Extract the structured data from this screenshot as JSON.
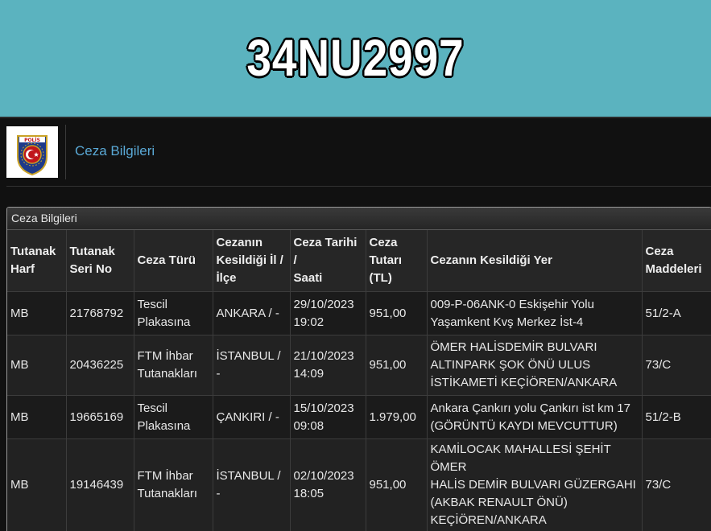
{
  "banner": {
    "plate": "34NU2997",
    "color": "#5bb3bf"
  },
  "panel": {
    "logo_icon": "polis-emblem-icon",
    "title": "Ceza Bilgileri"
  },
  "table": {
    "caption": "Ceza Bilgileri",
    "headers": [
      [
        "Tutanak",
        "Harf"
      ],
      [
        "Tutanak",
        "Seri No"
      ],
      [
        "Ceza Türü"
      ],
      [
        "Cezanın",
        "Kesildiği İl /",
        "İlçe"
      ],
      [
        "Ceza Tarihi /",
        "Saati"
      ],
      [
        "Ceza",
        "Tutarı",
        "(TL)"
      ],
      [
        "Cezanın Kesildiği Yer"
      ],
      [
        "Ceza",
        "Maddeleri"
      ]
    ],
    "rows": [
      {
        "harf": "MB",
        "seri_no": "21768792",
        "tur": [
          "Tescil",
          "Plakasına"
        ],
        "il_ilce": "ANKARA / -",
        "tarih": [
          "29/10/2023",
          "19:02"
        ],
        "tutar": "951,00",
        "yer": [
          "009-P-06ANK-0 Eskişehir Yolu",
          "Yaşamkent Kvş Merkez İst-4"
        ],
        "madde": "51/2-A"
      },
      {
        "harf": "MB",
        "seri_no": "20436225",
        "tur": [
          "FTM İhbar",
          "Tutanakları"
        ],
        "il_ilce": "İSTANBUL / -",
        "tarih": [
          "21/10/2023",
          "14:09"
        ],
        "tutar": "951,00",
        "yer": [
          "ÖMER HALİSDEMİR BULVARI",
          "ALTINPARK ŞOK ÖNÜ ULUS",
          "İSTİKAMETİ KEÇİÖREN/ANKARA"
        ],
        "madde": "73/C"
      },
      {
        "harf": "MB",
        "seri_no": "19665169",
        "tur": [
          "Tescil",
          "Plakasına"
        ],
        "il_ilce": "ÇANKIRI / -",
        "tarih": [
          "15/10/2023",
          "09:08"
        ],
        "tutar": "1.979,00",
        "yer": [
          "Ankara Çankırı yolu Çankırı ist km 17",
          "(GÖRÜNTÜ KAYDI MEVCUTTUR)"
        ],
        "madde": "51/2-B"
      },
      {
        "harf": "MB",
        "seri_no": "19146439",
        "tur": [
          "FTM İhbar",
          "Tutanakları"
        ],
        "il_ilce": "İSTANBUL / -",
        "tarih": [
          "02/10/2023",
          "18:05"
        ],
        "tutar": "951,00",
        "yer": [
          "KAMİLOCAK MAHALLESİ ŞEHİT ÖMER",
          "HALİS DEMİR BULVARI GÜZERGAHI",
          "(AKBAK RENAULT ÖNÜ)",
          "KEÇİÖREN/ANKARA"
        ],
        "madde": "73/C"
      }
    ]
  }
}
